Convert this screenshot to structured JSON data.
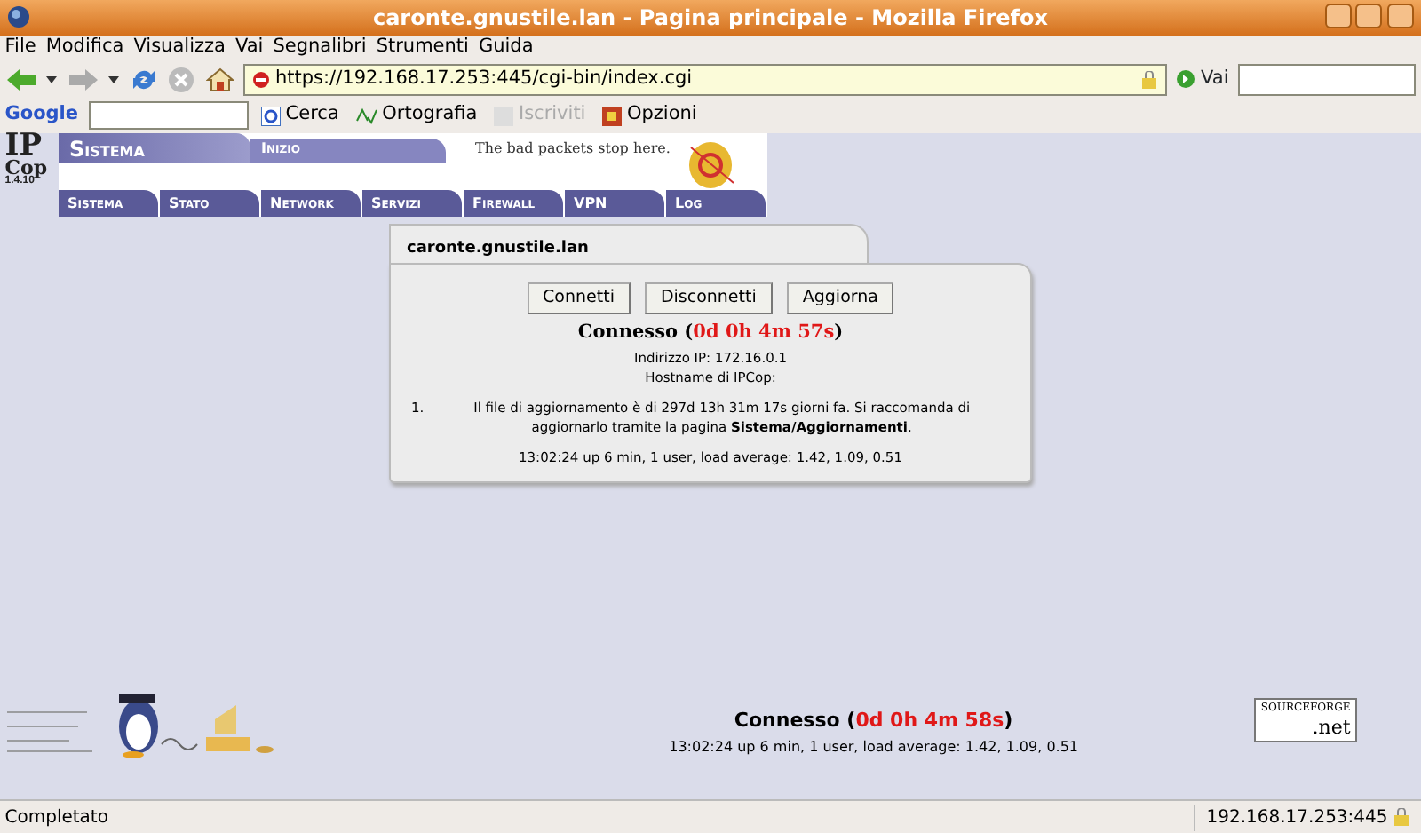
{
  "window": {
    "title": "caronte.gnustile.lan - Pagina principale - Mozilla Firefox"
  },
  "menu": [
    "File",
    "Modifica",
    "Visualizza",
    "Vai",
    "Segnalibri",
    "Strumenti",
    "Guida"
  ],
  "toolbar": {
    "url": "https://192.168.17.253:445/cgi-bin/index.cgi",
    "go": "Vai"
  },
  "google_bar": {
    "logo": "Google",
    "buttons": [
      {
        "label": "Cerca",
        "disabled": false
      },
      {
        "label": "Ortografia",
        "disabled": false
      },
      {
        "label": "Iscriviti",
        "disabled": true
      },
      {
        "label": "Opzioni",
        "disabled": false
      }
    ]
  },
  "header": {
    "logo_top": "IP",
    "logo_bottom": "Cop",
    "version": "1.4.10",
    "section": "Sistema",
    "page": "Inizio",
    "tagline": "The bad packets stop here.",
    "tabs": [
      "Sistema",
      "Stato",
      "Network",
      "Servizi",
      "Firewall",
      "VPN",
      "Log"
    ]
  },
  "card": {
    "title": "caronte.gnustile.lan",
    "buttons": [
      "Connetti",
      "Disconnetti",
      "Aggiorna"
    ],
    "status": "Connesso (",
    "uptime": "0d 0h 4m 57s",
    "status_end": ")",
    "ip": "Indirizzo IP: 172.16.0.1",
    "hostname": "Hostname di IPCop:",
    "notes": [
      {
        "number": "1.",
        "text": "Il file di aggiornamento è di 297d 13h 31m 17s giorni fa. Si raccomanda di aggiornarlo tramite la pagina **Sistema/Aggiornamenti**."
      }
    ],
    "load": "13:02:24 up 6 min, 1 user, load average: 1.42, 1.09, 0.51"
  },
  "footer": {
    "status": "Connesso (",
    "uptime": "0d 0h 4m 58s",
    "status_end": ")",
    "load": "13:02:24 up 6 min, 1 user, load average: 1.42, 1.09, 0.51",
    "sourceforge_top": "SOURCEFORGE",
    "sourceforge_bottom": ".net"
  },
  "status_bar": {
    "text": "Completato",
    "host": "192.168.17.253:445"
  }
}
